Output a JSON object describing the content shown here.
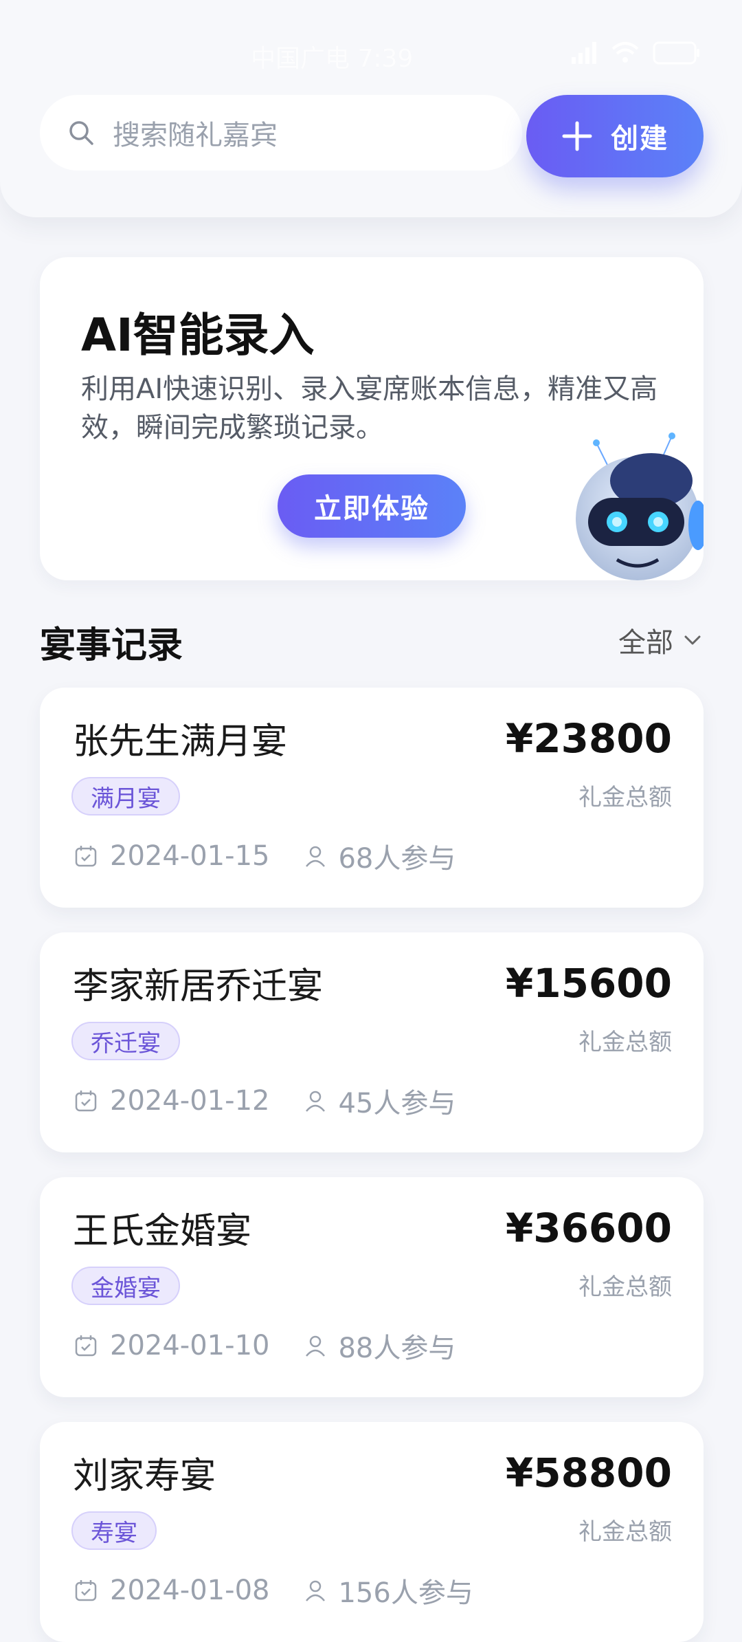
{
  "status_bar": {
    "carrier": "中国广电 7:39"
  },
  "search": {
    "placeholder": "搜索随礼嘉宾"
  },
  "create_button": {
    "label": "创建"
  },
  "ai_card": {
    "title": "AI智能录入",
    "description": "利用AI快速识别、录入宴席账本信息，精准又高效，瞬间完成繁琐记录。",
    "button_label": "立即体验"
  },
  "records": {
    "section_title": "宴事记录",
    "filter_label": "全部",
    "amount_label": "礼金总额",
    "items": [
      {
        "name": "张先生满月宴",
        "tag": "满月宴",
        "amount": "¥23800",
        "date": "2024-01-15",
        "participants": "68人参与"
      },
      {
        "name": "李家新居乔迁宴",
        "tag": "乔迁宴",
        "amount": "¥15600",
        "date": "2024-01-12",
        "participants": "45人参与"
      },
      {
        "name": "王氏金婚宴",
        "tag": "金婚宴",
        "amount": "¥36600",
        "date": "2024-01-10",
        "participants": "88人参与"
      },
      {
        "name": "刘家寿宴",
        "tag": "寿宴",
        "amount": "¥58800",
        "date": "2024-01-08",
        "participants": "156人参与"
      }
    ]
  },
  "colors": {
    "accent_start": "#6a5cf3",
    "accent_end": "#5b82f8",
    "tag_text": "#6b55d8"
  }
}
